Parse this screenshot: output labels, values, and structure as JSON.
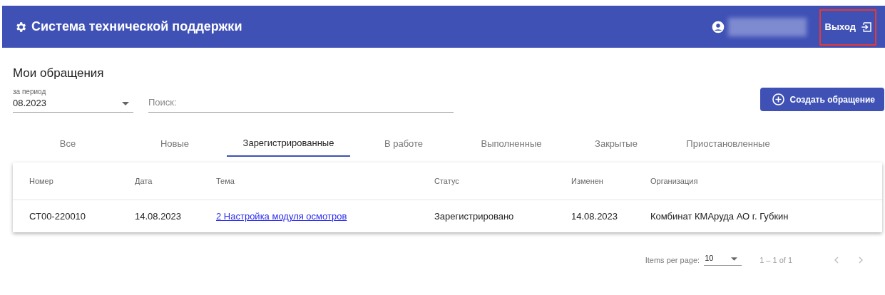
{
  "header": {
    "title": "Система технической поддержки",
    "logout": "Выход",
    "user_name_redacted": true,
    "logout_highlighted": true
  },
  "page_title": "Мои обращения",
  "filters": {
    "period": {
      "label": "за период",
      "value": "08.2023"
    },
    "search": {
      "placeholder": "Поиск:"
    }
  },
  "create_button": "Создать обращение",
  "tabs": [
    {
      "label": "Все",
      "selected": false
    },
    {
      "label": "Новые",
      "selected": false
    },
    {
      "label": "Зарегистрированные",
      "selected": true
    },
    {
      "label": "В работе",
      "selected": false
    },
    {
      "label": "Выполненные",
      "selected": false
    },
    {
      "label": "Закрытые",
      "selected": false
    },
    {
      "label": "Приостановленные",
      "selected": false
    }
  ],
  "table": {
    "columns": [
      "Номер",
      "Дата",
      "Тема",
      "Статус",
      "Изменен",
      "Организация"
    ],
    "rows": [
      {
        "cells": [
          "СТ00-220010",
          "14.08.2023",
          "2 Настройка модуля осмотров",
          "Зарегистрировано",
          "14.08.2023",
          "Комбинат КМАруда АО г. Губкин"
        ]
      }
    ]
  },
  "pagination": {
    "label": "Items per page:",
    "page_size": "10",
    "range": "1 – 1 of 1"
  }
}
